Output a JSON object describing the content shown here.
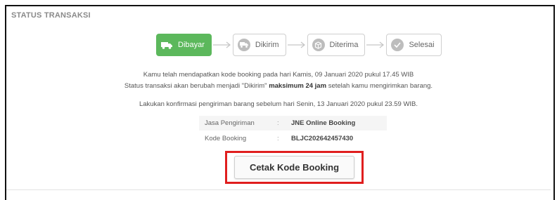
{
  "section_title": "STATUS TRANSAKSI",
  "steps": [
    {
      "label": "Dibayar",
      "icon": "truck-icon",
      "active": true
    },
    {
      "label": "Dikirim",
      "icon": "truck-icon",
      "active": false
    },
    {
      "label": "Diterima",
      "icon": "package-icon",
      "active": false
    },
    {
      "label": "Selesai",
      "icon": "check-icon",
      "active": false
    }
  ],
  "info": {
    "line1": "Kamu telah mendapatkan kode booking pada hari Kamis, 09 Januari 2020 pukul 17.45 WIB",
    "line2_before": "Status transaksi akan berubah menjadi \"Dikirim\"",
    "line2_bold": "maksimum 24 jam",
    "line2_after": "setelah kamu mengirimkan barang.",
    "line3": "Lakukan konfirmasi pengiriman barang sebelum hari Senin, 13 Januari 2020 pukul 23.59 WIB."
  },
  "details": [
    {
      "label": "Jasa Pengiriman",
      "sep": ":",
      "value": "JNE Online Booking"
    },
    {
      "label": "Kode Booking",
      "sep": ":",
      "value": "BLJC202642457430"
    }
  ],
  "print_button_label": "Cetak Kode Booking",
  "colors": {
    "active_step": "#5cb85c",
    "highlight": "#e01e1e"
  }
}
